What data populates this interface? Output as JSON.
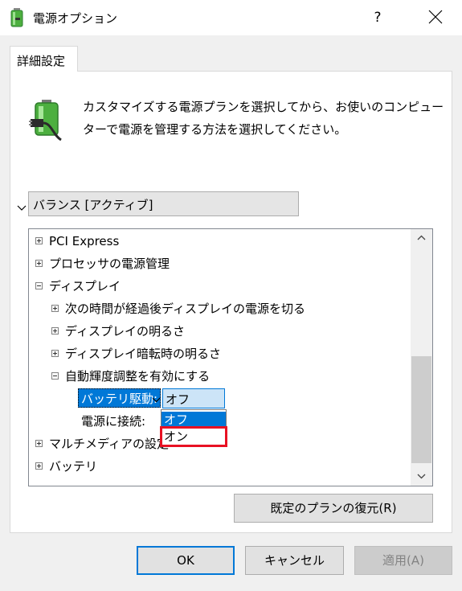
{
  "window": {
    "title": "電源オプション",
    "help_label": "?"
  },
  "tabs": [
    {
      "label": "詳細設定"
    }
  ],
  "description": "カスタマイズする電源プランを選択してから、お使いのコンピューターで電源を管理する方法を選択してください。",
  "plan_select": {
    "value": "バランス [アクティブ]"
  },
  "tree": {
    "items": [
      {
        "label": "PCI Express",
        "state": "collapsed"
      },
      {
        "label": "プロセッサの電源管理",
        "state": "collapsed"
      },
      {
        "label": "ディスプレイ",
        "state": "expanded"
      },
      {
        "label": "次の時間が経過後ディスプレイの電源を切る",
        "state": "collapsed"
      },
      {
        "label": "ディスプレイの明るさ",
        "state": "collapsed"
      },
      {
        "label": "ディスプレイ暗転時の明るさ",
        "state": "collapsed"
      },
      {
        "label": "自動輝度調整を有効にする",
        "state": "expanded"
      },
      {
        "label": "マルチメディアの設定",
        "state": "collapsed"
      },
      {
        "label": "バッテリ",
        "state": "collapsed"
      }
    ],
    "battery_setting": {
      "label": "バッテリ駆動:",
      "value": "オフ"
    },
    "ac_setting": {
      "label": "電源に接続:"
    },
    "dropdown_options": [
      "オフ",
      "オン"
    ],
    "selected_option": "オフ",
    "highlighted_option": "オン"
  },
  "buttons": {
    "restore": "既定のプランの復元(R)",
    "ok": "OK",
    "cancel": "キャンセル",
    "apply": "適用(A)"
  },
  "colors": {
    "selection_blue": "#0078d7",
    "highlight_red": "#e81123",
    "battery_green": "#4caf3f"
  }
}
